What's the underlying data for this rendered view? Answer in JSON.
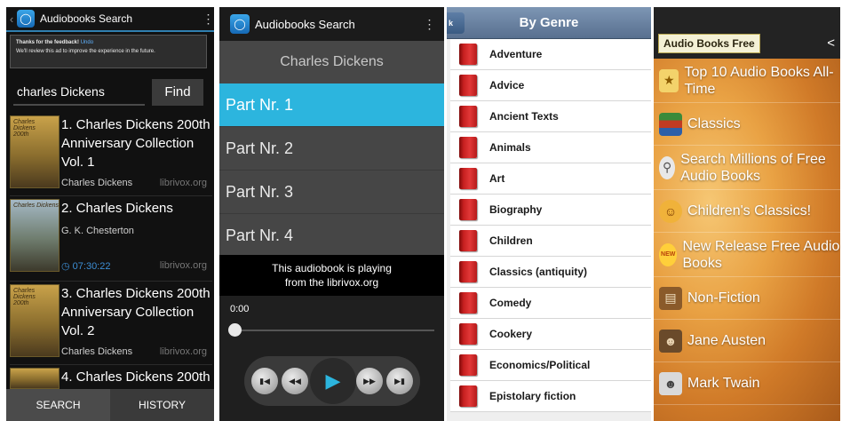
{
  "search_screen": {
    "app_title": "Audiobooks Search",
    "ad_line1": "Thanks for the feedback!",
    "ad_undo": "Undo",
    "ad_line2": "We'll review this ad to improve the experience in the future.",
    "search_value": "charles Dickens",
    "find_label": "Find",
    "results": [
      {
        "title": "1. Charles Dickens 200th Anniversary Collection Vol. 1",
        "author": "Charles Dickens",
        "duration": "",
        "source": "librivox.org"
      },
      {
        "title": "2. Charles Dickens",
        "author": "G. K. Chesterton",
        "duration": "07:30:22",
        "source": "librivox.org"
      },
      {
        "title": "3. Charles Dickens 200th Anniversary Collection Vol. 2",
        "author": "Charles Dickens",
        "duration": "",
        "source": "librivox.org"
      },
      {
        "title": "4. Charles Dickens 200th",
        "author": "",
        "duration": "",
        "source": ""
      }
    ],
    "tabs": [
      "SEARCH",
      "HISTORY"
    ]
  },
  "player_screen": {
    "app_title": "Audiobooks Search",
    "book_title": "Charles Dickens",
    "parts": [
      "Part Nr. 1",
      "Part Nr. 2",
      "Part Nr. 3",
      "Part Nr. 4"
    ],
    "selected_part_index": 0,
    "playing_line1": "This audiobook is playing",
    "playing_line2": "from the librivox.org",
    "time": "0:00",
    "progress_percent": 0,
    "accent_color": "#2cb5de"
  },
  "genre_screen": {
    "back_label": "k",
    "title": "By Genre",
    "genres": [
      "Adventure",
      "Advice",
      "Ancient Texts",
      "Animals",
      "Art",
      "Biography",
      "Children",
      "Classics (antiquity)",
      "Comedy",
      "Cookery",
      "Economics/Political",
      "Epistolary fiction"
    ]
  },
  "free_screen": {
    "logo_text": "Audio Books Free",
    "items": [
      {
        "label": "Top 10 Audio Books All-Time",
        "icon": "trophy-icon"
      },
      {
        "label": "Classics",
        "icon": "books-icon"
      },
      {
        "label": "Search Millions of Free Audio Books",
        "icon": "search-icon"
      },
      {
        "label": "Children's Classics!",
        "icon": "child-icon"
      },
      {
        "label": "New Release Free Audio Books",
        "icon": "new-badge-icon"
      },
      {
        "label": "Non-Fiction",
        "icon": "book-icon"
      },
      {
        "label": "Jane Austen",
        "icon": "portrait-icon"
      },
      {
        "label": "Mark Twain",
        "icon": "portrait-icon"
      }
    ]
  }
}
